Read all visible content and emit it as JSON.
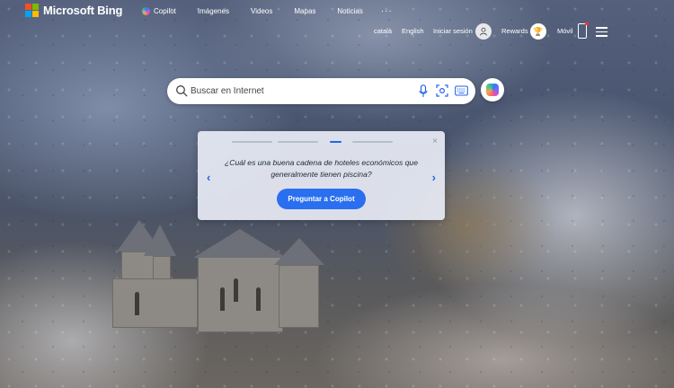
{
  "brand": {
    "name": "Microsoft Bing",
    "logo_colors": [
      "#f25022",
      "#7fba00",
      "#00a4ef",
      "#ffb900"
    ]
  },
  "nav": {
    "items": [
      "Copilot",
      "Imágenes",
      "Videos",
      "Mapas",
      "Noticias"
    ],
    "more": "···"
  },
  "header_right": {
    "lang1": "català",
    "lang2": "English",
    "signin": "Iniciar sesión",
    "rewards": "Rewards",
    "mobile": "Móvil"
  },
  "search": {
    "placeholder": "Buscar en Internet"
  },
  "copilot_card": {
    "question": "¿Cuál es una buena cadena de hoteles económicos que generalmente tienen piscina?",
    "button": "Preguntar a Copilot",
    "close": "×",
    "prev": "‹",
    "next": "›",
    "active_slide": 3,
    "slide_count": 4
  },
  "colors": {
    "accent": "#2a6ff0"
  }
}
